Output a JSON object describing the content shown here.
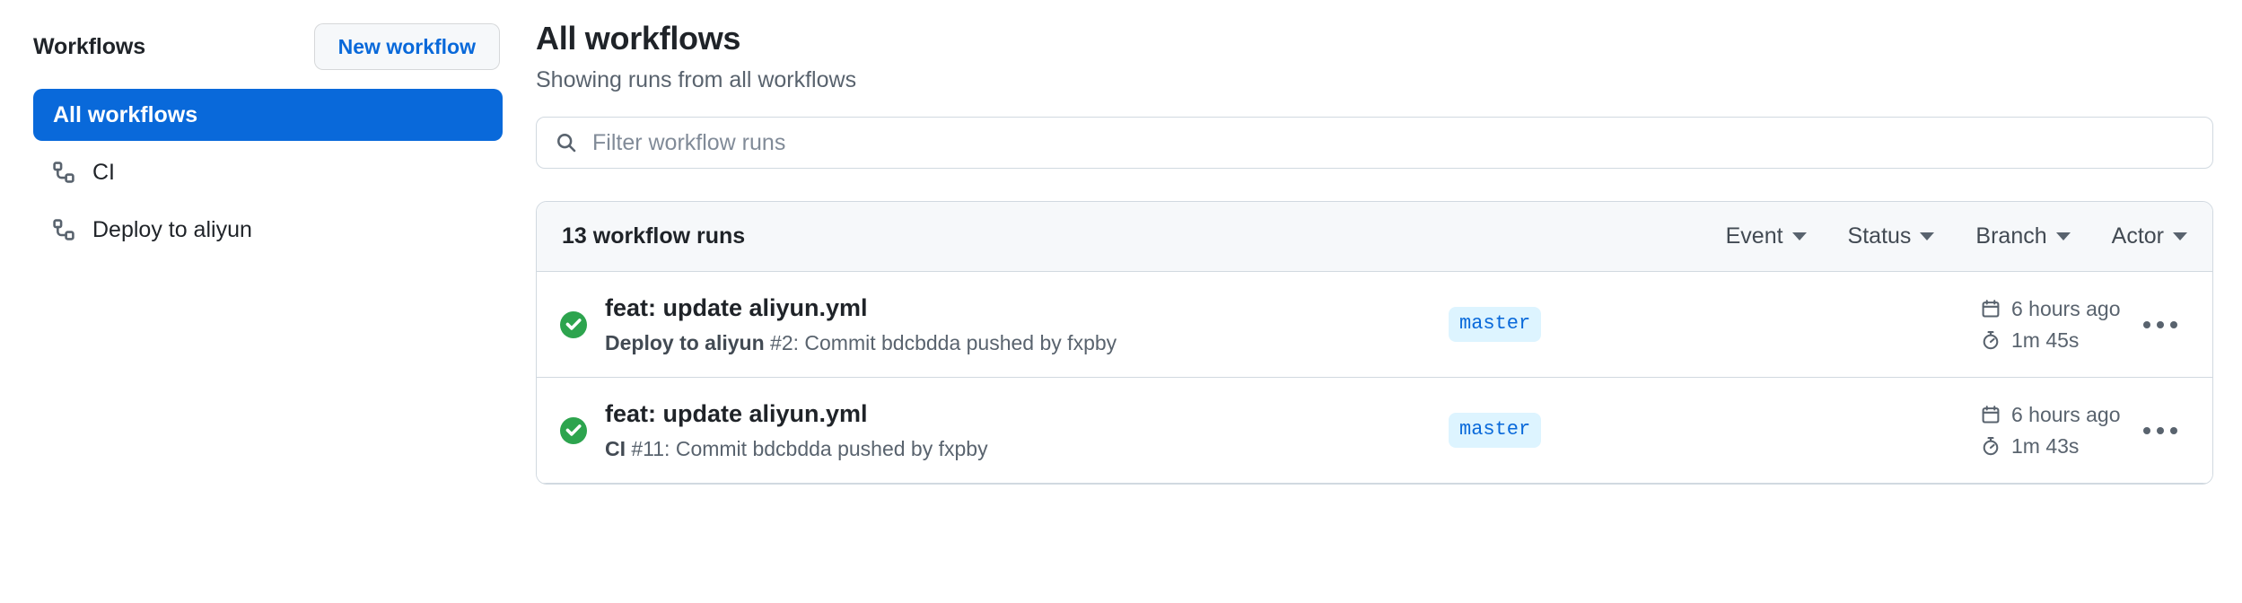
{
  "sidebar": {
    "title": "Workflows",
    "new_workflow_label": "New workflow",
    "items": [
      {
        "label": "All workflows",
        "icon": "none",
        "selected": true
      },
      {
        "label": "CI",
        "icon": "workflow-icon",
        "selected": false
      },
      {
        "label": "Deploy to aliyun",
        "icon": "workflow-icon",
        "selected": false
      }
    ]
  },
  "main": {
    "title": "All workflows",
    "subtitle": "Showing runs from all workflows",
    "search": {
      "icon": "search-icon",
      "placeholder": "Filter workflow runs",
      "value": ""
    },
    "runs_header": {
      "count_label": "13 workflow runs",
      "filters": [
        {
          "label": "Event"
        },
        {
          "label": "Status"
        },
        {
          "label": "Branch"
        },
        {
          "label": "Actor"
        }
      ]
    },
    "runs": [
      {
        "status": "success",
        "status_icon": "check-circle-icon",
        "title": "feat: update aliyun.yml",
        "workflow_name": "Deploy to aliyun",
        "meta_rest": " #2: Commit bdcbdda pushed by fxpby",
        "branch": "master",
        "time_icon": "calendar-icon",
        "time_ago": "6 hours ago",
        "duration_icon": "stopwatch-icon",
        "duration": "1m 45s",
        "kebab_icon": "kebab-horizontal-icon"
      },
      {
        "status": "success",
        "status_icon": "check-circle-icon",
        "title": "feat: update aliyun.yml",
        "workflow_name": "CI",
        "meta_rest": " #11: Commit bdcbdda pushed by fxpby",
        "branch": "master",
        "time_icon": "calendar-icon",
        "time_ago": "6 hours ago",
        "duration_icon": "stopwatch-icon",
        "duration": "1m 43s",
        "kebab_icon": "kebab-horizontal-icon"
      }
    ]
  },
  "colors": {
    "accent": "#0969da",
    "success": "#2da44e",
    "badge_bg": "#ddf4ff",
    "border": "#d1d9e0",
    "muted_text": "#59636e",
    "header_bg": "#f6f8fa"
  }
}
